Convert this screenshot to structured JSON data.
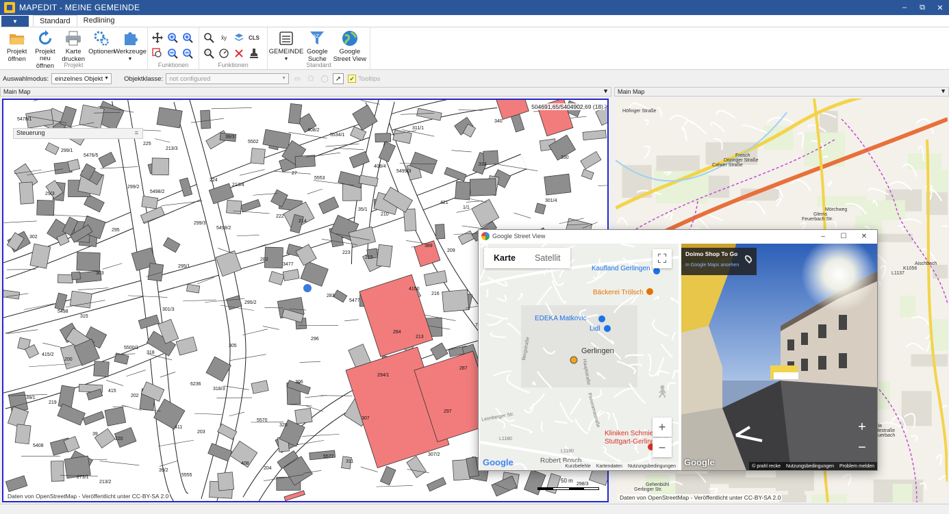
{
  "app": {
    "title": "MAPEDIT - MEINE GEMEINDE"
  },
  "window_controls": {
    "minimize": "–",
    "restore": "⧉",
    "close": "✕"
  },
  "ribbon_tabs": [
    "Standard",
    "Redlining"
  ],
  "ribbon": {
    "projekt": {
      "label": "Projekt",
      "buttons": [
        {
          "label": "Projekt öffnen",
          "icon": "folder-open-icon"
        },
        {
          "label": "Projekt neu öffnen",
          "icon": "refresh-icon"
        },
        {
          "label": "Karte drucken",
          "icon": "printer-icon"
        },
        {
          "label": "Optionen",
          "icon": "gears-icon"
        },
        {
          "label": "Werkzeuge",
          "icon": "puzzle-icon"
        }
      ]
    },
    "funktionen1": {
      "label": "Funktionen"
    },
    "funktionen2": {
      "label": "Funktionen",
      "cls": "CLS"
    },
    "standard": {
      "label": "Standard",
      "buttons": [
        {
          "label": "GEMEINDE",
          "icon": "building-icon"
        },
        {
          "label": "Google Suche",
          "icon": "sort-az-icon"
        },
        {
          "label": "Google Street View",
          "icon": "globe-icon"
        }
      ]
    }
  },
  "selection_bar": {
    "auswahlmodus_label": "Auswahlmodus:",
    "auswahlmodus_value": "einzelnes Objekt",
    "objektklasse_label": "Objektklasse:",
    "objektklasse_placeholder": "not configured",
    "tooltips_label": "Tooltips",
    "tooltips_checked": true
  },
  "panels": {
    "left": {
      "header": "Main Map",
      "coords": "504691,65/5404902,69 (18)",
      "steuerung": "Steuerung",
      "scale": "50 m",
      "attribution": "Daten von OpenStreetMap - Veröffentlicht unter CC-BY-SA 2.0",
      "parcels": [
        "5478/1",
        "5476/5",
        "5498/2",
        "5499/2",
        "3477",
        "5477",
        "213",
        "217/1",
        "212/1",
        "5408",
        "213/2",
        "213/3",
        "213/4",
        "214",
        "215",
        "216",
        "218/4",
        "218/1",
        "219",
        "220",
        "5555",
        "5502",
        "5553",
        "210",
        "209",
        "206/1",
        "201",
        "200",
        "202",
        "203",
        "204",
        "5534/1",
        "5499/3",
        "1/1",
        "321",
        "316",
        "315",
        "318",
        "318/3",
        "320",
        "311",
        "311/1",
        "313",
        "301/4",
        "302",
        "303",
        "301/3",
        "305",
        "306",
        "307",
        "307/2",
        "340",
        "330",
        "29/3",
        "295",
        "295/1",
        "295/2",
        "296",
        "294/1",
        "297",
        "298",
        "298/3",
        "299/1",
        "299/2",
        "299/3",
        "282",
        "283",
        "284",
        "287",
        "276",
        "275",
        "273/1",
        "225",
        "224",
        "222",
        "223",
        "4150",
        "7179",
        "16",
        "39/1",
        "39",
        "39/2",
        "39/3",
        "27",
        "35/1",
        "389",
        "424",
        "423/3",
        "415/2",
        "415",
        "411",
        "408",
        "408/2",
        "408/4",
        "421",
        "423",
        "429/1",
        "5498",
        "5500/1",
        "6236",
        "5570",
        "5577"
      ]
    },
    "right": {
      "header": "Main Map",
      "attribution": "Daten von OpenStreetMap - Veröffentlicht unter CC-BY-SA 2.0",
      "labels": [
        "Höfinger Straße",
        "Calwer Straße",
        "Feuerbach Str.",
        "L1137",
        "L1137",
        "A81",
        "Stuttgart-Feuerbach",
        "Gerlinger Str.",
        "Ditzinger Straße",
        "Glems",
        "K1056",
        "Herdweg",
        "Lehmgruben",
        "Solitudestraße",
        "Gehenbühl",
        "Frosch",
        "Mörchweg",
        "Aischbach",
        "Hitzeweg",
        "Kallenbergstraße",
        "Ha"
      ]
    }
  },
  "street_view": {
    "window_title": "Google Street View",
    "map_tabs": [
      "Karte",
      "Satellit"
    ],
    "pois": [
      "Kaufland Gerlingen",
      "Bäckerei Trölsch",
      "EDEKA Matkovic",
      "Lidl",
      "Gerlingen",
      "Kliniken Schmieder",
      "Stuttgart-Gerlingen",
      "Robert Bosch"
    ],
    "streets": [
      "Leonberger Str.",
      "Panoramastraße",
      "Hauptstraße",
      "Bergstraße",
      "L1180",
      "L1180"
    ],
    "map_footer": [
      "Kurzbefehle",
      "Kartendaten",
      "Nutzungsbedingungen"
    ],
    "google": "Google",
    "pano_title": "Doimo Shop To Go",
    "pano_link": "In Google Maps ansehen",
    "pano_footer": [
      "© prahl recke",
      "Nutzungsbedingungen",
      "Problem melden"
    ],
    "zoom_in": "+",
    "zoom_out": "−"
  }
}
